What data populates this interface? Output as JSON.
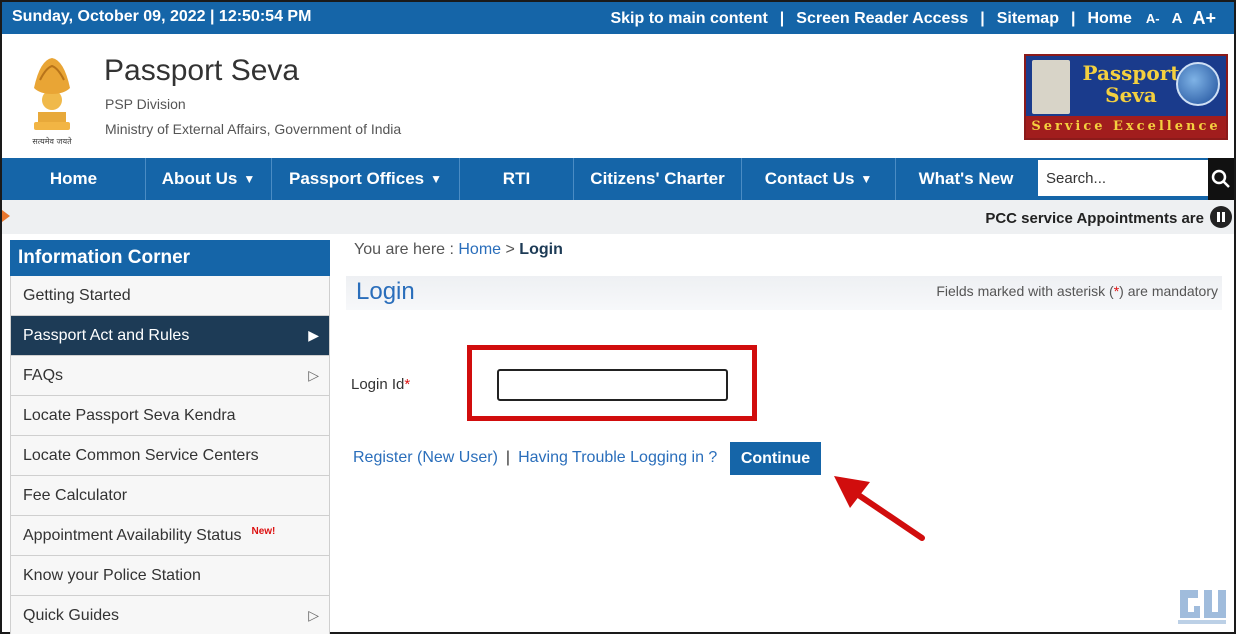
{
  "topbar": {
    "date": "Sunday,  October  09, 2022 | 12:50:54 PM",
    "links": [
      "Skip to main content",
      "Screen Reader Access",
      "Sitemap",
      "Home"
    ],
    "font_small": "A-",
    "font_normal": "A",
    "font_large": "A+"
  },
  "header": {
    "title": "Passport Seva",
    "division": "PSP Division",
    "ministry": "Ministry of External Affairs, Government of India",
    "emblem_motto": "सत्यमेव जयते",
    "logo_title": "Passport Seva",
    "logo_tagline": "Service Excellence"
  },
  "nav": {
    "items": [
      {
        "label": "Home",
        "dropdown": false
      },
      {
        "label": "About Us",
        "dropdown": true
      },
      {
        "label": "Passport Offices",
        "dropdown": true
      },
      {
        "label": "RTI",
        "dropdown": false
      },
      {
        "label": "Citizens' Charter",
        "dropdown": false
      },
      {
        "label": "Contact Us",
        "dropdown": true
      },
      {
        "label": "What's New",
        "dropdown": false
      }
    ],
    "search_placeholder": "Search..."
  },
  "ticker": {
    "text": "PCC service Appointments are"
  },
  "sidebar": {
    "title": "Information Corner",
    "items": [
      {
        "label": "Getting Started"
      },
      {
        "label": "Passport Act and Rules"
      },
      {
        "label": "FAQs"
      },
      {
        "label": "Locate Passport Seva Kendra"
      },
      {
        "label": "Locate Common Service Centers"
      },
      {
        "label": "Fee Calculator"
      },
      {
        "label": "Appointment Availability Status",
        "badge": "New!"
      },
      {
        "label": "Know your Police Station"
      },
      {
        "label": "Quick Guides"
      }
    ]
  },
  "breadcrumb": {
    "prefix": "You are here : ",
    "home": "Home",
    "separator": " > ",
    "current": "Login"
  },
  "login": {
    "title": "Login",
    "mandatory_pre": "Fields marked with asterisk (",
    "mandatory_ast": "*",
    "mandatory_post": ") are mandatory",
    "login_id_label": "Login Id",
    "asterisk": "*",
    "login_id_value": "",
    "register_link": "Register (New User)",
    "pipe": "|",
    "trouble_link": "Having Trouble Logging in ?",
    "continue_label": "Continue"
  },
  "colors": {
    "primary_blue": "#1565a8",
    "sidebar_active": "#1d3b56",
    "highlight_red": "#d10d0d",
    "ticker_orange": "#e8772e"
  }
}
